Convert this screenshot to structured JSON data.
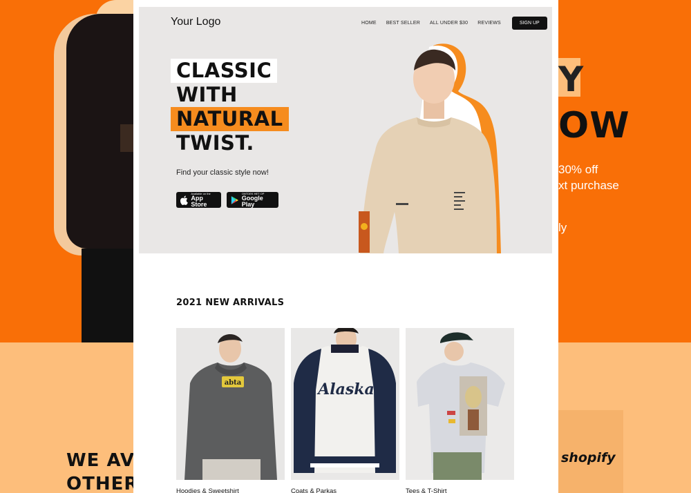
{
  "background": {
    "heading_partial_1": "Y",
    "heading_partial_2": "OW",
    "offer_line_1": "30% off",
    "offer_line_2": "xt purchase",
    "offer_line_3": "ly",
    "partner_brand": "shopify",
    "footer_heading_1": "WE AVA",
    "footer_heading_2": "OTHER",
    "colors": {
      "orange": "#f96f07",
      "peach": "#fdbe7b"
    }
  },
  "header": {
    "logo": "Your Logo",
    "nav": [
      {
        "label": "HOME"
      },
      {
        "label": "BEST SELLER"
      },
      {
        "label": "ALL UNDER $30"
      },
      {
        "label": "REVIEWS"
      }
    ],
    "signup_label": "SIGN UP"
  },
  "hero": {
    "headline": [
      "CLASSIC",
      "WITH",
      "NATURAL",
      "TWIST."
    ],
    "tagline": "Find your classic style now!",
    "app_store": {
      "small": "Available on the",
      "big": "App Store",
      "icon": "apple-icon"
    },
    "google_play": {
      "small": "ONTDEK HET OP",
      "big": "Google Play",
      "icon": "google-play-icon"
    },
    "accent_color": "#f68c1e"
  },
  "arrivals": {
    "title": "2021 NEW ARRIVALS",
    "products": [
      {
        "label": "Hoodies & Sweetshirt",
        "graphic_text": "abta"
      },
      {
        "label": "Coats & Parkas",
        "graphic_text": "Alaska"
      },
      {
        "label": "Tees & T-Shirt"
      }
    ]
  }
}
